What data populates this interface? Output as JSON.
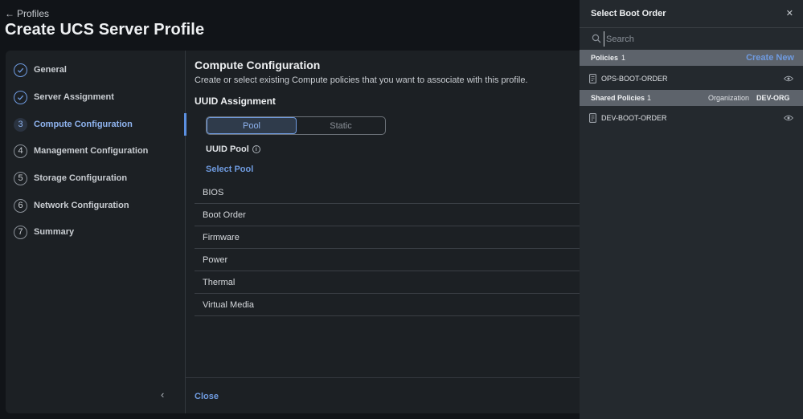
{
  "header": {
    "back_label": "Profiles",
    "page_title": "Create UCS Server Profile"
  },
  "steps": [
    {
      "num": "",
      "label": "General",
      "state": "done"
    },
    {
      "num": "",
      "label": "Server Assignment",
      "state": "done"
    },
    {
      "num": "3",
      "label": "Compute Configuration",
      "state": "active"
    },
    {
      "num": "4",
      "label": "Management Configuration",
      "state": "pending"
    },
    {
      "num": "5",
      "label": "Storage Configuration",
      "state": "pending"
    },
    {
      "num": "6",
      "label": "Network Configuration",
      "state": "pending"
    },
    {
      "num": "7",
      "label": "Summary",
      "state": "pending"
    }
  ],
  "content": {
    "title": "Compute Configuration",
    "subtitle": "Create or select existing Compute policies that you want to associate with this profile.",
    "section_title": "UUID Assignment",
    "toggle": {
      "pool": "Pool",
      "static": "Static"
    },
    "pool_label": "UUID Pool",
    "select_pool": "Select Pool",
    "policies": [
      "BIOS",
      "Boot Order",
      "Firmware",
      "Power",
      "Thermal",
      "Virtual Media"
    ],
    "close_label": "Close"
  },
  "panel": {
    "title": "Select Boot Order",
    "search_placeholder": "Search",
    "policies_group": {
      "label": "Policies",
      "count": "1",
      "create_new": "Create New"
    },
    "policies": [
      "OPS-BOOT-ORDER"
    ],
    "shared_group": {
      "label": "Shared Policies",
      "count": "1",
      "org_label": "Organization",
      "org_value": "DEV-ORG"
    },
    "shared_policies": [
      "DEV-BOOT-ORDER"
    ]
  }
}
